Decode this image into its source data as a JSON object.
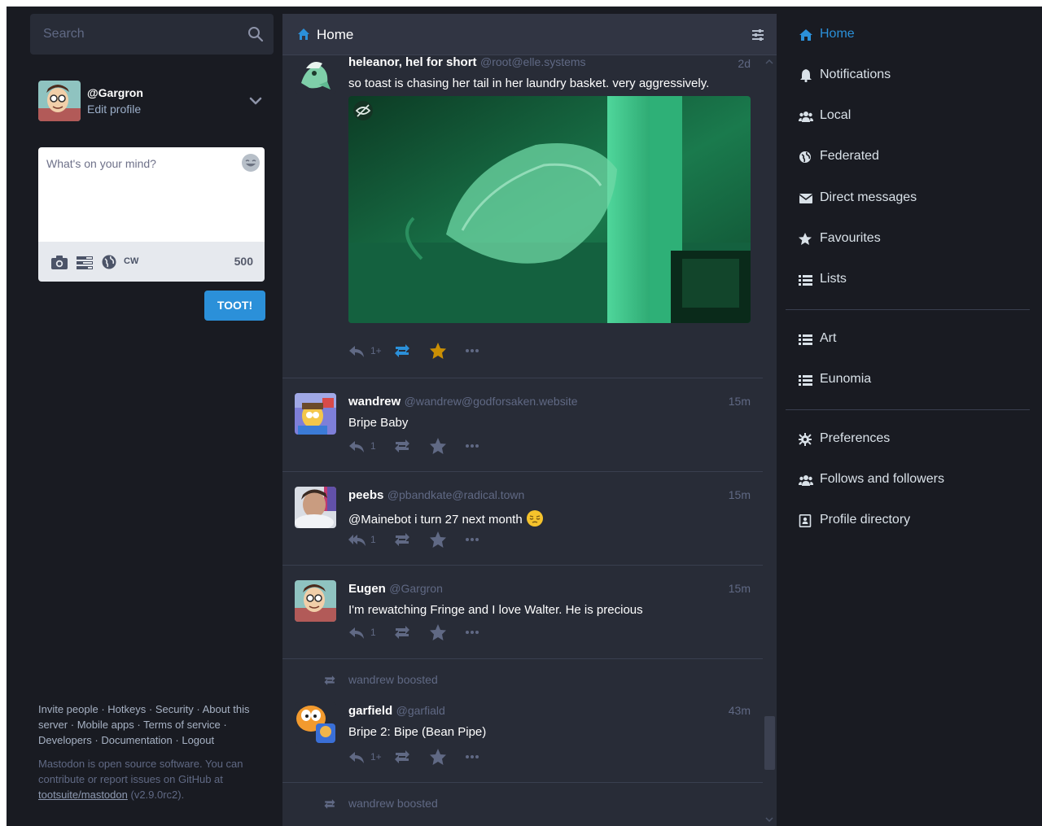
{
  "search": {
    "placeholder": "Search"
  },
  "account": {
    "handle": "@Gargron",
    "edit_label": "Edit profile"
  },
  "compose": {
    "placeholder": "What's on your mind?",
    "cw_label": "CW",
    "char_count": "500",
    "submit_label": "TOOT!"
  },
  "footer": {
    "links": [
      "Invite people",
      "Hotkeys",
      "Security",
      "About this server",
      "Mobile apps",
      "Terms of service",
      "Developers",
      "Documentation",
      "Logout"
    ],
    "about_text": "Mastodon is open source software. You can contribute or report issues on GitHub at",
    "repo_link": "tootsuite/mastodon",
    "version": "(v2.9.0rc2)."
  },
  "column": {
    "title": "Home"
  },
  "statuses": [
    {
      "display_name": "heleanor, hel for short",
      "acct": "@root@elle.systems",
      "time": "2d",
      "content": "so toast is chasing her tail in her laundry basket. very aggressively.",
      "reply_count": "1+",
      "favourited": true
    },
    {
      "display_name": "wandrew",
      "acct": "@wandrew@godforsaken.website",
      "time": "15m",
      "content": "Bripe Baby",
      "reply_count": "1"
    },
    {
      "display_name": "peebs",
      "acct": "@pbandkate@radical.town",
      "time": "15m",
      "content": "@Mainebot i turn 27 next month",
      "reply_count": "1"
    },
    {
      "display_name": "Eugen",
      "acct": "@Gargron",
      "time": "15m",
      "content": "I'm rewatching Fringe and I love Walter. He is precious",
      "reply_count": "1"
    },
    {
      "boosted_by": "wandrew boosted",
      "display_name": "garfield",
      "acct": "@garfiald",
      "time": "43m",
      "content": "Bripe 2: Bipe (Bean Pipe)",
      "reply_count": "1+"
    }
  ],
  "next_boost": "wandrew boosted",
  "nav": {
    "main": [
      {
        "label": "Home",
        "icon": "home-icon"
      },
      {
        "label": "Notifications",
        "icon": "bell-icon"
      },
      {
        "label": "Local",
        "icon": "users-icon"
      },
      {
        "label": "Federated",
        "icon": "globe-icon"
      },
      {
        "label": "Direct messages",
        "icon": "envelope-icon"
      },
      {
        "label": "Favourites",
        "icon": "star-icon"
      },
      {
        "label": "Lists",
        "icon": "list-icon"
      }
    ],
    "lists": [
      {
        "label": "Art",
        "icon": "list-icon"
      },
      {
        "label": "Eunomia",
        "icon": "list-icon"
      }
    ],
    "settings": [
      {
        "label": "Preferences",
        "icon": "cog-icon"
      },
      {
        "label": "Follows and followers",
        "icon": "users-icon"
      },
      {
        "label": "Profile directory",
        "icon": "address-book-icon"
      }
    ]
  },
  "colors": {
    "accent": "#2b90d9",
    "favourite": "#ca8f04",
    "background": "#191b22",
    "column": "#282c37"
  }
}
